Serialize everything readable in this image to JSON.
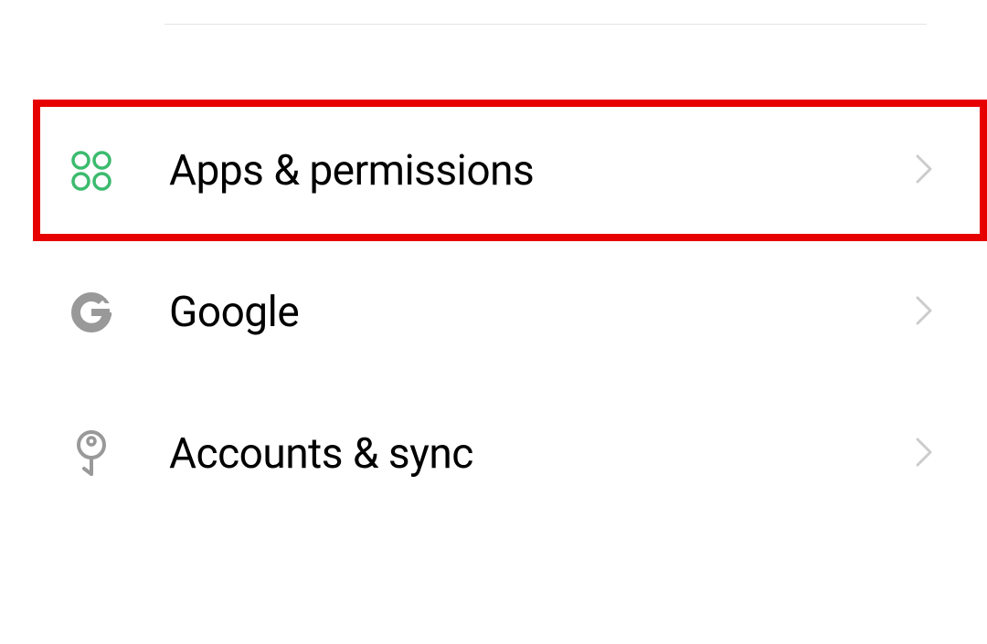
{
  "settings": {
    "items": [
      {
        "label": "Apps & permissions",
        "icon": "clover-icon",
        "highlighted": true
      },
      {
        "label": "Google",
        "icon": "google-icon",
        "highlighted": false
      },
      {
        "label": "Accounts & sync",
        "icon": "key-icon",
        "highlighted": false
      }
    ]
  },
  "colors": {
    "clover": "#3bbb6e",
    "iconGray": "#999999",
    "chevron": "#cccccc",
    "highlight": "#e60000"
  }
}
